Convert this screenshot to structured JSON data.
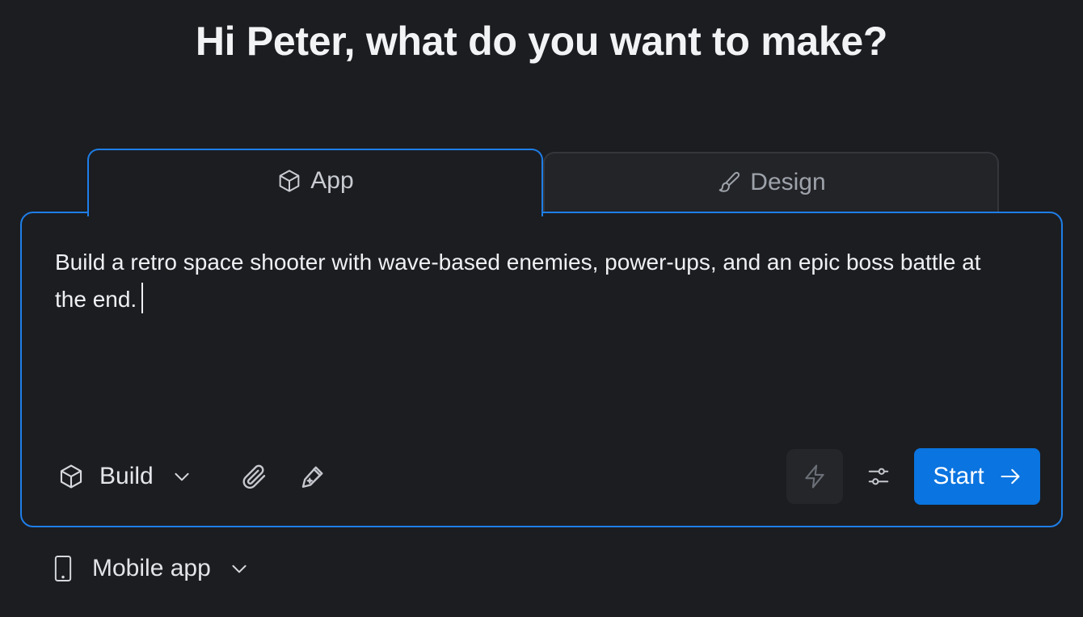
{
  "greeting": "Hi Peter, what do you want to make?",
  "tabs": [
    {
      "label": "App",
      "icon": "cube-icon",
      "active": true
    },
    {
      "label": "Design",
      "icon": "brush-icon",
      "active": false
    }
  ],
  "prompt": {
    "value": "Build a retro space shooter with wave-based enemies, power-ups, and an epic boss battle at the end."
  },
  "toolbar": {
    "mode_label": "Build",
    "mode_icon": "cube-icon",
    "attach_icon": "paperclip-icon",
    "enhance_icon": "magic-pen-icon",
    "fast_icon": "lightning-icon",
    "settings_icon": "sliders-icon",
    "start_label": "Start"
  },
  "platform": {
    "label": "Mobile app",
    "icon": "phone-icon"
  },
  "colors": {
    "background": "#1c1d21",
    "accent": "#1e7ee8",
    "start_button": "#0a74e0"
  }
}
